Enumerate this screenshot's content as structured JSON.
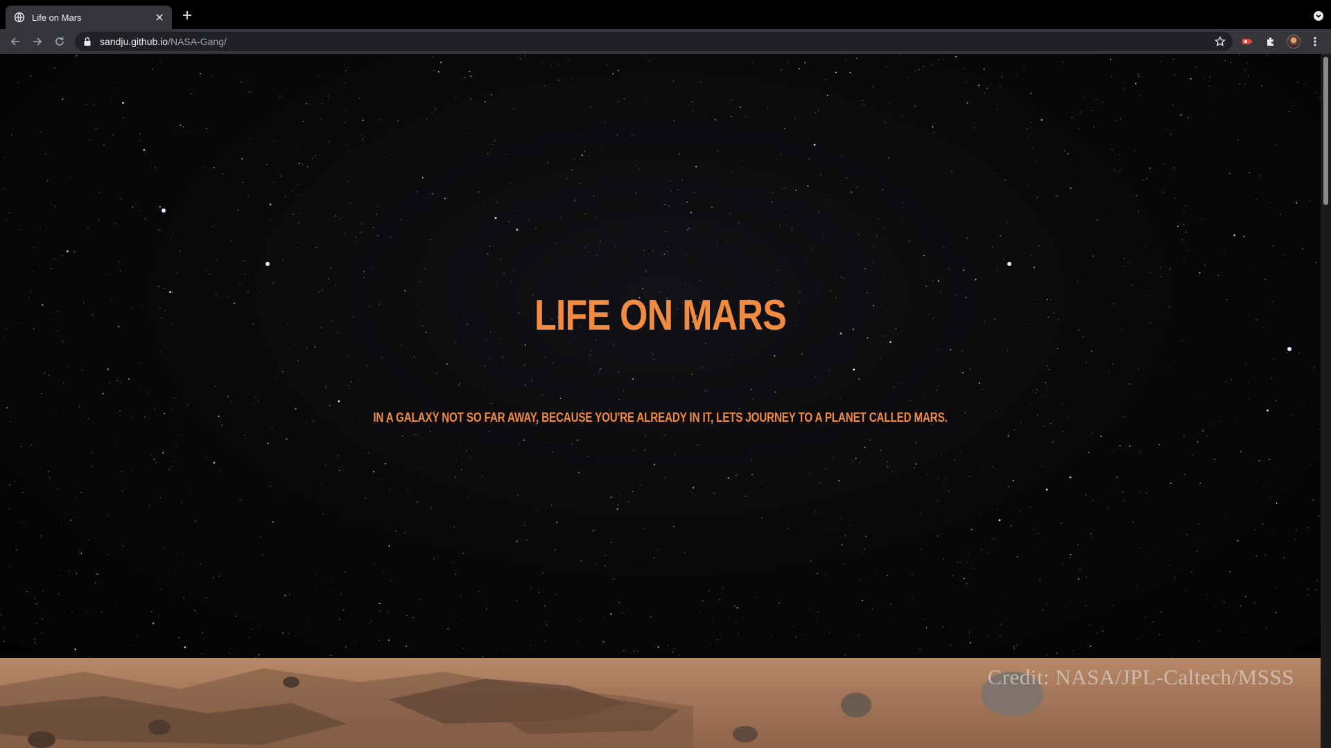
{
  "browser": {
    "tab_title": "Life on Mars",
    "url_host": "sandju.github.io",
    "url_path": "/NASA-Gang/"
  },
  "hero": {
    "title": "LIFE ON MARS",
    "subtitle": "IN A GALAXY NOT SO FAR AWAY, BECAUSE YOU'RE ALREADY IN IT, LETS JOURNEY TO A PLANET CALLED MARS."
  },
  "banner": {
    "credit": "Credit: NASA/JPL-Caltech/MSSS"
  },
  "colors": {
    "accent": "#f28b42",
    "chrome": "#35363a",
    "omnibox": "#202124"
  },
  "icons": [
    "globe-icon",
    "close-icon",
    "plus-icon",
    "tab-search-icon",
    "back-icon",
    "forward-icon",
    "reload-icon",
    "lock-icon",
    "star-icon",
    "extension-red-icon",
    "puzzle-icon",
    "avatar",
    "kebab-menu-icon"
  ]
}
